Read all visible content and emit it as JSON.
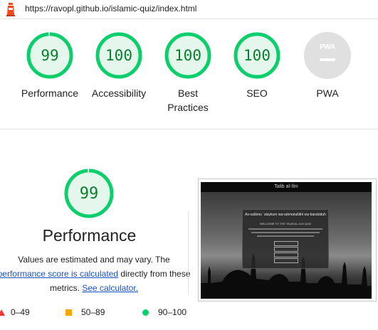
{
  "url": "https://ravopl.github.io/islamic-quiz/index.html",
  "categories": [
    {
      "label": "Performance",
      "score": "99",
      "score_fraction": 0.99
    },
    {
      "label": "Accessibility",
      "score": "100",
      "score_fraction": 1.0
    },
    {
      "label_line1": "Best",
      "label_line2": "Practices",
      "score": "100",
      "score_fraction": 1.0
    },
    {
      "label": "SEO",
      "score": "100",
      "score_fraction": 1.0
    },
    {
      "label": "PWA",
      "badge": "PWA"
    }
  ],
  "performance": {
    "score": "99",
    "score_fraction": 0.99,
    "title": "Performance",
    "desc_line1": "Values are estimated and may vary. The",
    "desc_link1": "performance score is calculated",
    "desc_line2_rest": " directly from these",
    "desc_line3_text": "metrics. ",
    "desc_link2": "See calculator."
  },
  "legend": [
    {
      "range": "0–49",
      "color": "#ff3333"
    },
    {
      "range": "50–89",
      "color": "#ffa400"
    },
    {
      "range": "90–100",
      "color": "#0cce6b"
    }
  ],
  "screenshot": {
    "site_title": "Talib al-Ilm",
    "greeting": "As-salāmu ʿalaykum wa-raḥmatullāhi wa-barakātuh",
    "welcome": "WELCOME TO THE TALIB AL-ILM QUIZ"
  },
  "colors": {
    "pass_green": "#0cce6b",
    "pass_fill": "#e5f7ec",
    "pass_text": "#0a7f2e",
    "pwa_gray": "#e0e0e0",
    "link_blue": "#1a53c7"
  }
}
